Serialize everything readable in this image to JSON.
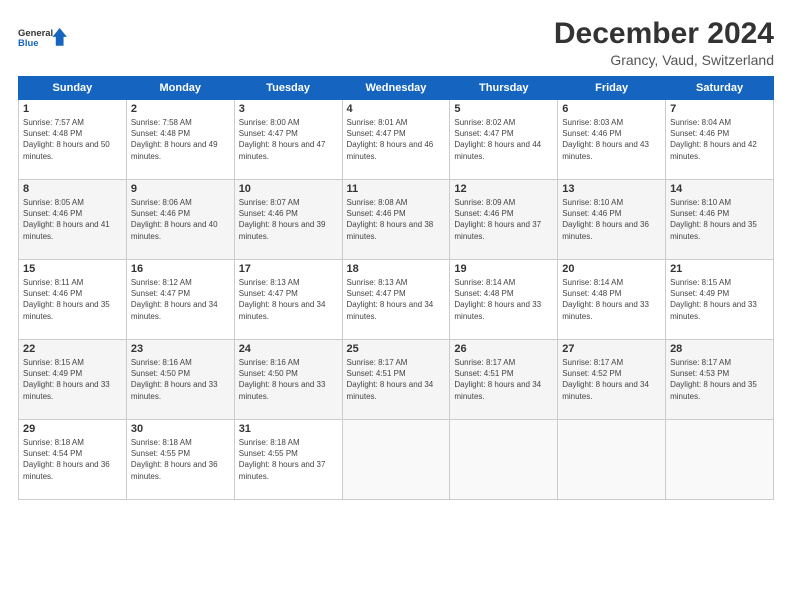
{
  "logo": {
    "general": "General",
    "blue": "Blue"
  },
  "title": "December 2024",
  "subtitle": "Grancy, Vaud, Switzerland",
  "days_header": [
    "Sunday",
    "Monday",
    "Tuesday",
    "Wednesday",
    "Thursday",
    "Friday",
    "Saturday"
  ],
  "weeks": [
    [
      {
        "day": "1",
        "sunrise": "7:57 AM",
        "sunset": "4:48 PM",
        "daylight": "8 hours and 50 minutes."
      },
      {
        "day": "2",
        "sunrise": "7:58 AM",
        "sunset": "4:48 PM",
        "daylight": "8 hours and 49 minutes."
      },
      {
        "day": "3",
        "sunrise": "8:00 AM",
        "sunset": "4:47 PM",
        "daylight": "8 hours and 47 minutes."
      },
      {
        "day": "4",
        "sunrise": "8:01 AM",
        "sunset": "4:47 PM",
        "daylight": "8 hours and 46 minutes."
      },
      {
        "day": "5",
        "sunrise": "8:02 AM",
        "sunset": "4:47 PM",
        "daylight": "8 hours and 44 minutes."
      },
      {
        "day": "6",
        "sunrise": "8:03 AM",
        "sunset": "4:46 PM",
        "daylight": "8 hours and 43 minutes."
      },
      {
        "day": "7",
        "sunrise": "8:04 AM",
        "sunset": "4:46 PM",
        "daylight": "8 hours and 42 minutes."
      }
    ],
    [
      {
        "day": "8",
        "sunrise": "8:05 AM",
        "sunset": "4:46 PM",
        "daylight": "8 hours and 41 minutes."
      },
      {
        "day": "9",
        "sunrise": "8:06 AM",
        "sunset": "4:46 PM",
        "daylight": "8 hours and 40 minutes."
      },
      {
        "day": "10",
        "sunrise": "8:07 AM",
        "sunset": "4:46 PM",
        "daylight": "8 hours and 39 minutes."
      },
      {
        "day": "11",
        "sunrise": "8:08 AM",
        "sunset": "4:46 PM",
        "daylight": "8 hours and 38 minutes."
      },
      {
        "day": "12",
        "sunrise": "8:09 AM",
        "sunset": "4:46 PM",
        "daylight": "8 hours and 37 minutes."
      },
      {
        "day": "13",
        "sunrise": "8:10 AM",
        "sunset": "4:46 PM",
        "daylight": "8 hours and 36 minutes."
      },
      {
        "day": "14",
        "sunrise": "8:10 AM",
        "sunset": "4:46 PM",
        "daylight": "8 hours and 35 minutes."
      }
    ],
    [
      {
        "day": "15",
        "sunrise": "8:11 AM",
        "sunset": "4:46 PM",
        "daylight": "8 hours and 35 minutes."
      },
      {
        "day": "16",
        "sunrise": "8:12 AM",
        "sunset": "4:47 PM",
        "daylight": "8 hours and 34 minutes."
      },
      {
        "day": "17",
        "sunrise": "8:13 AM",
        "sunset": "4:47 PM",
        "daylight": "8 hours and 34 minutes."
      },
      {
        "day": "18",
        "sunrise": "8:13 AM",
        "sunset": "4:47 PM",
        "daylight": "8 hours and 34 minutes."
      },
      {
        "day": "19",
        "sunrise": "8:14 AM",
        "sunset": "4:48 PM",
        "daylight": "8 hours and 33 minutes."
      },
      {
        "day": "20",
        "sunrise": "8:14 AM",
        "sunset": "4:48 PM",
        "daylight": "8 hours and 33 minutes."
      },
      {
        "day": "21",
        "sunrise": "8:15 AM",
        "sunset": "4:49 PM",
        "daylight": "8 hours and 33 minutes."
      }
    ],
    [
      {
        "day": "22",
        "sunrise": "8:15 AM",
        "sunset": "4:49 PM",
        "daylight": "8 hours and 33 minutes."
      },
      {
        "day": "23",
        "sunrise": "8:16 AM",
        "sunset": "4:50 PM",
        "daylight": "8 hours and 33 minutes."
      },
      {
        "day": "24",
        "sunrise": "8:16 AM",
        "sunset": "4:50 PM",
        "daylight": "8 hours and 33 minutes."
      },
      {
        "day": "25",
        "sunrise": "8:17 AM",
        "sunset": "4:51 PM",
        "daylight": "8 hours and 34 minutes."
      },
      {
        "day": "26",
        "sunrise": "8:17 AM",
        "sunset": "4:51 PM",
        "daylight": "8 hours and 34 minutes."
      },
      {
        "day": "27",
        "sunrise": "8:17 AM",
        "sunset": "4:52 PM",
        "daylight": "8 hours and 34 minutes."
      },
      {
        "day": "28",
        "sunrise": "8:17 AM",
        "sunset": "4:53 PM",
        "daylight": "8 hours and 35 minutes."
      }
    ],
    [
      {
        "day": "29",
        "sunrise": "8:18 AM",
        "sunset": "4:54 PM",
        "daylight": "8 hours and 36 minutes."
      },
      {
        "day": "30",
        "sunrise": "8:18 AM",
        "sunset": "4:55 PM",
        "daylight": "8 hours and 36 minutes."
      },
      {
        "day": "31",
        "sunrise": "8:18 AM",
        "sunset": "4:55 PM",
        "daylight": "8 hours and 37 minutes."
      },
      null,
      null,
      null,
      null
    ]
  ]
}
